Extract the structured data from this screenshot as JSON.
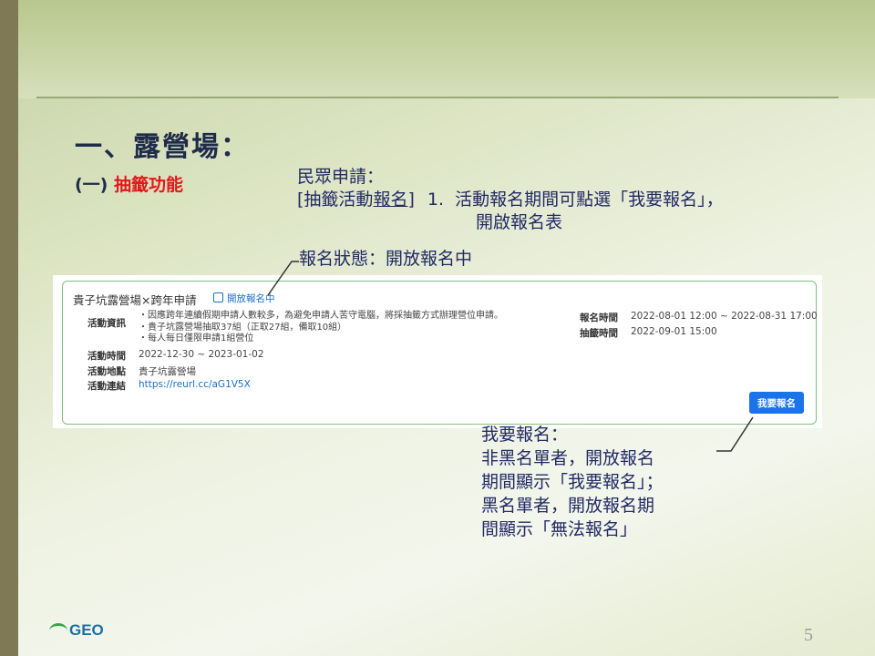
{
  "slide": {
    "title": "一、露營場：",
    "subtitle_num": "(一)",
    "subtitle_text": "抽籤功能",
    "note1": {
      "line1": "民眾申請：",
      "bracket_open": "[",
      "word_a": "抽籤活動",
      "word_b": "報名",
      "bracket_close": "]",
      "item_num": "1.",
      "item_text1": "活動報名期間可點選「我要報名」，",
      "item_text2": "開啟報名表"
    },
    "status_note": "報名狀態：開放報名中",
    "signup_note": [
      "我要報名：",
      "非黑名單者，開放報名",
      "期間顯示「我要報名」；",
      "黑名單者，開放報名期",
      "間顯示「無法報名」"
    ],
    "page_number": "5",
    "logo_text": "GEO"
  },
  "card": {
    "title": "貴子坑露營場×跨年申請",
    "status": "開放報名中",
    "info_label": "活動資訊",
    "info_lines": [
      "・因應跨年連續假期申請人數較多，為避免申請人苦守電腦，將採抽籤方式辦理營位申請。",
      "・貴子坑露營場抽取37組（正取27組，備取10組）",
      "・每人每日僅限申請1組營位"
    ],
    "time_label": "活動時間",
    "time_value": "2022-12-30 ~ 2023-01-02",
    "place_label": "活動地點",
    "place_value": "貴子坑露營場",
    "link_label": "活動連結",
    "link_value": "https://reurl.cc/aG1V5X",
    "signup_time_label": "報名時間",
    "signup_time_value": "2022-08-01 12:00 ~ 2022-08-31 17:00",
    "draw_time_label": "抽籤時間",
    "draw_time_value": "2022-09-01 15:00",
    "signup_button": "我要報名"
  },
  "colors": {
    "title": "#1f2b4a",
    "subtitle_red": "#e2191b",
    "note": "#222a66",
    "link": "#1a6fc9",
    "button": "#1a73e8",
    "card_border": "#7cc27c"
  }
}
